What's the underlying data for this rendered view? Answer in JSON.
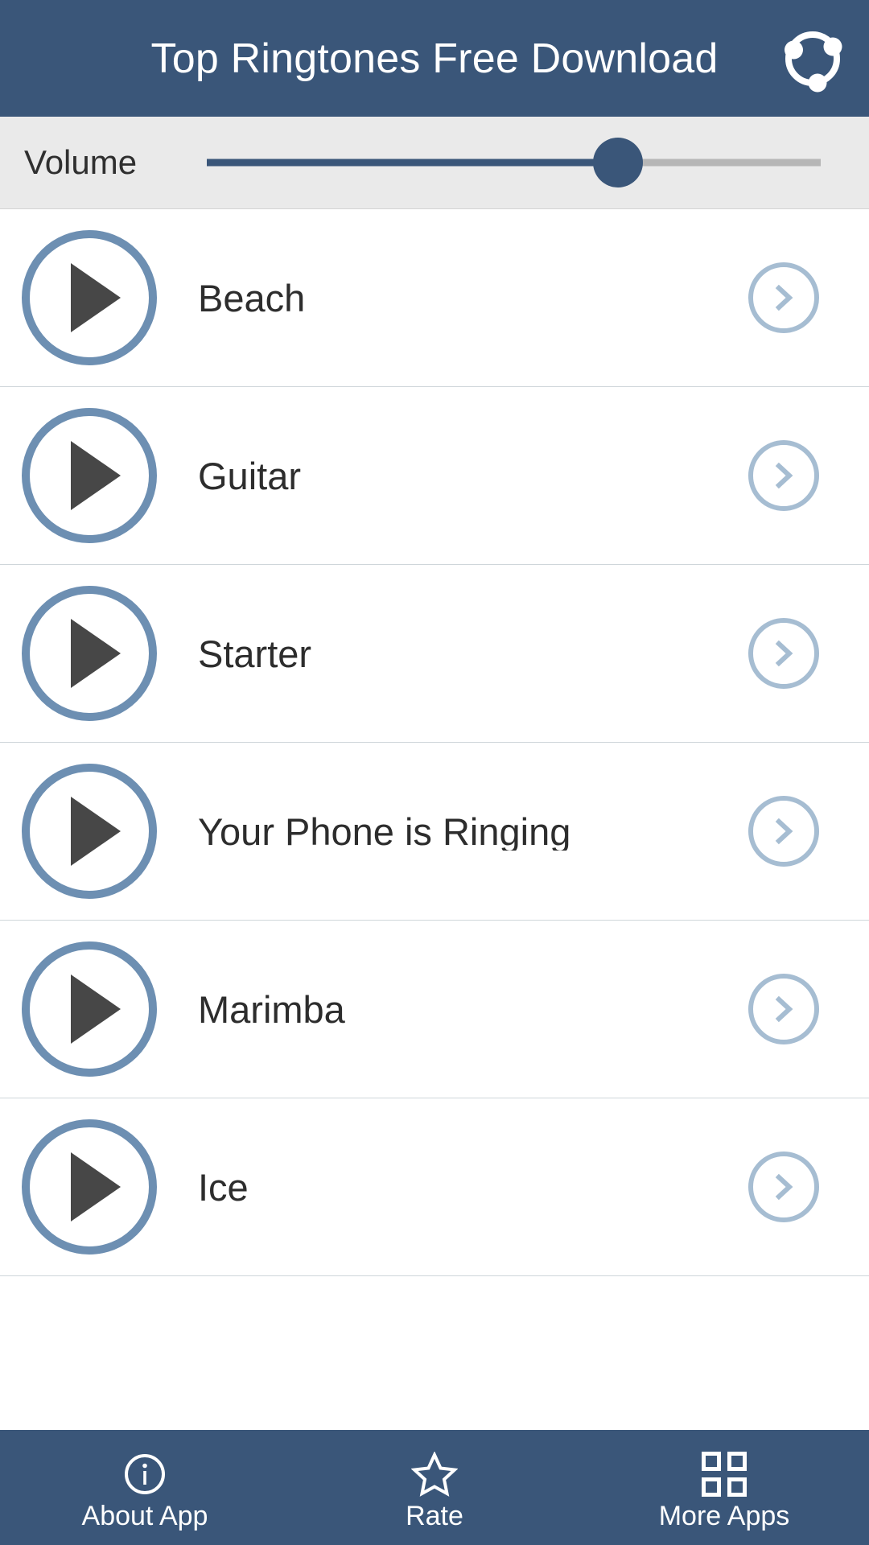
{
  "header": {
    "title": "Top Ringtones Free Download",
    "action_icon": "share-network-icon",
    "background_color": "#3a5679",
    "text_color": "#ffffff"
  },
  "volume": {
    "label": "Volume",
    "value_percent": 67,
    "track_color": "#b6b6b6",
    "fill_color": "#3a5679",
    "thumb_color": "#3a5679",
    "background_color": "#eaeaea"
  },
  "ringtones": [
    {
      "name": "Beach",
      "play_icon": "play-icon",
      "chevron_icon": "chevron-right-icon"
    },
    {
      "name": "Guitar",
      "play_icon": "play-icon",
      "chevron_icon": "chevron-right-icon"
    },
    {
      "name": "Starter",
      "play_icon": "play-icon",
      "chevron_icon": "chevron-right-icon"
    },
    {
      "name": "Your Phone is Ringing",
      "play_icon": "play-icon",
      "chevron_icon": "chevron-right-icon"
    },
    {
      "name": "Marimba",
      "play_icon": "play-icon",
      "chevron_icon": "chevron-right-icon"
    },
    {
      "name": "Ice",
      "play_icon": "play-icon",
      "chevron_icon": "chevron-right-icon"
    }
  ],
  "list_style": {
    "play_ring_color": "#6d8fb2",
    "play_triangle_color": "#474747",
    "chevron_color": "#a6bdd2",
    "divider_color": "#cfd6da",
    "title_color": "#2d2d2d"
  },
  "bottom_nav": {
    "background_color": "#3a5679",
    "items": [
      {
        "label": "About App",
        "icon": "info-circle-icon"
      },
      {
        "label": "Rate",
        "icon": "star-outline-icon"
      },
      {
        "label": "More Apps",
        "icon": "grid-apps-icon"
      }
    ]
  }
}
